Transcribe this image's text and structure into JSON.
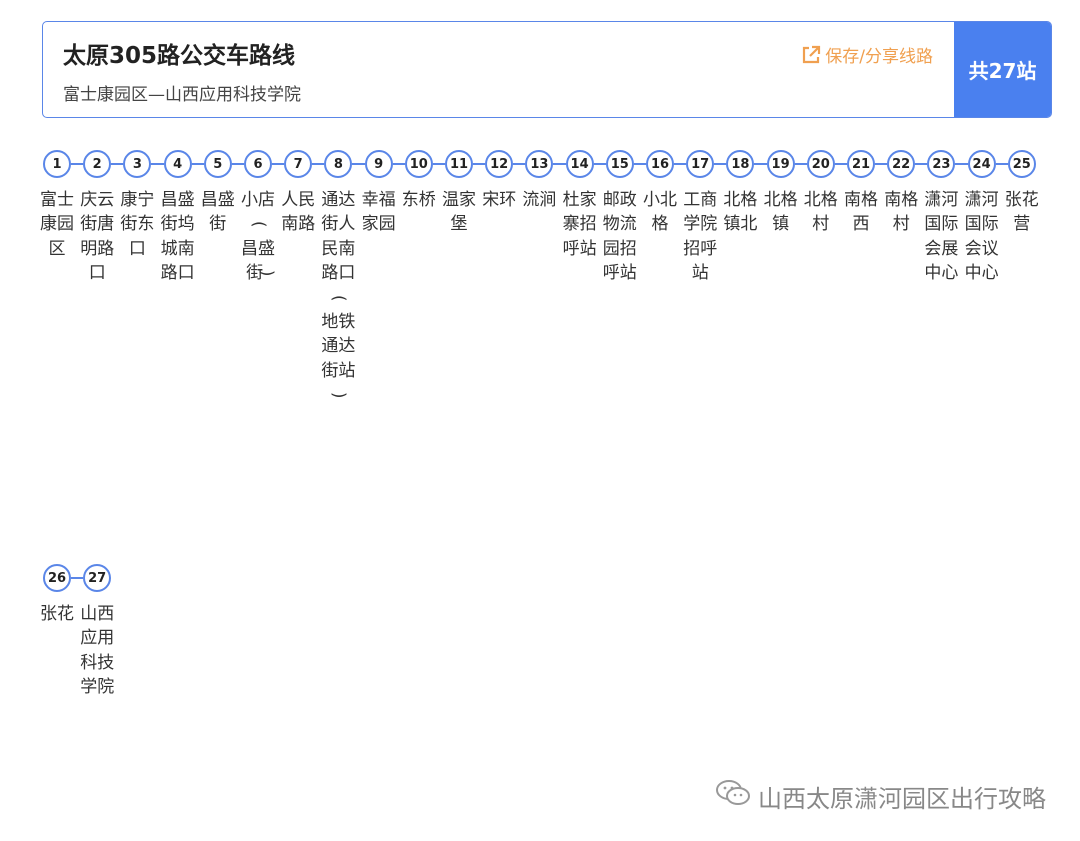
{
  "header": {
    "title": "太原305路公交车路线",
    "subtitle": "富士康园区—山西应用科技学院",
    "save_label": "保存/分享线路",
    "count_label": "共27站"
  },
  "colors": {
    "accent": "#4a80ef",
    "line": "#5a86e8",
    "save": "#f0a050"
  },
  "stops": [
    {
      "num": "1",
      "name": "富士康园区"
    },
    {
      "num": "2",
      "name": "庆云街唐明路口"
    },
    {
      "num": "3",
      "name": "康宁街东口"
    },
    {
      "num": "4",
      "name": "昌盛街坞城南路口"
    },
    {
      "num": "5",
      "name": "昌盛街"
    },
    {
      "num": "6",
      "name": "小店(昌盛街)"
    },
    {
      "num": "7",
      "name": "人民南路"
    },
    {
      "num": "8",
      "name": "通达街人民南路口(地铁通达街站)"
    },
    {
      "num": "9",
      "name": "幸福家园"
    },
    {
      "num": "10",
      "name": "东桥"
    },
    {
      "num": "11",
      "name": "温家堡"
    },
    {
      "num": "12",
      "name": "宋环"
    },
    {
      "num": "13",
      "name": "流涧"
    },
    {
      "num": "14",
      "name": "杜家寨招呼站"
    },
    {
      "num": "15",
      "name": "邮政物流园招呼站"
    },
    {
      "num": "16",
      "name": "小北格"
    },
    {
      "num": "17",
      "name": "工商学院招呼站"
    },
    {
      "num": "18",
      "name": "北格镇北"
    },
    {
      "num": "19",
      "name": "北格镇"
    },
    {
      "num": "20",
      "name": "北格村"
    },
    {
      "num": "21",
      "name": "南格西"
    },
    {
      "num": "22",
      "name": "南格村"
    },
    {
      "num": "23",
      "name": "潇河国际会展中心"
    },
    {
      "num": "24",
      "name": "潇河国际会议中心"
    },
    {
      "num": "25",
      "name": "张花营"
    },
    {
      "num": "26",
      "name": "张花"
    },
    {
      "num": "27",
      "name": "山西应用科技学院"
    }
  ],
  "watermark": {
    "icon": "wechat-icon",
    "text": "山西太原潇河园区出行攻略"
  }
}
